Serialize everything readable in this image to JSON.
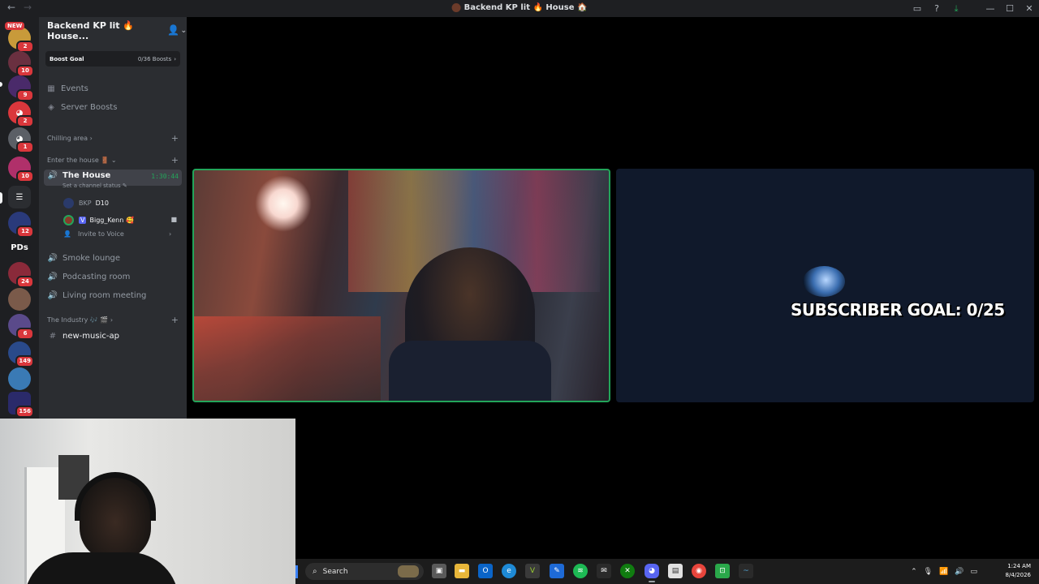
{
  "window": {
    "title": "Backend KP lit 🔥 House 🏠",
    "nav_back": "←",
    "nav_forward": "→"
  },
  "rail": {
    "new_label": "NEW",
    "dm_glyph": "PDs",
    "badges": [
      "2",
      "10",
      "9",
      "2",
      "1",
      "10",
      "12",
      "24",
      "6",
      "149",
      "156"
    ]
  },
  "server": {
    "name": "Backend KP lit 🔥 House...",
    "boost_goal_label": "Boost Goal",
    "boost_goal_count": "0/36 Boosts",
    "events_label": "Events",
    "server_boosts_label": "Server Boosts"
  },
  "categories": {
    "chilling": "Chilling area",
    "enter": "Enter the house 🚪",
    "industry": "The Industry 🎶 🎬"
  },
  "voice": {
    "active_channel": "The House",
    "active_time": "1:30:44",
    "status_prompt": "Set a channel status",
    "users": [
      {
        "name": "BKP",
        "tag": "D10"
      },
      {
        "name": "Bigg_Kenn",
        "prefix": "V"
      }
    ],
    "invite_label": "Invite to Voice"
  },
  "channels": {
    "smoke": "Smoke lounge",
    "podcast": "Podcasting room",
    "living": "Living room meeting",
    "music": "new-music-ap"
  },
  "stream": {
    "goal_text": "SUBSCRIBER GOAL: 0/25"
  },
  "taskbar": {
    "search_placeholder": "Search",
    "time": "1:24 AM",
    "date": "8/4/2026"
  },
  "colors": {
    "speaking_border": "#23a55a",
    "mention_badge": "#da373c",
    "sidebar_bg": "#2b2d31",
    "rail_bg": "#1e1f22"
  }
}
